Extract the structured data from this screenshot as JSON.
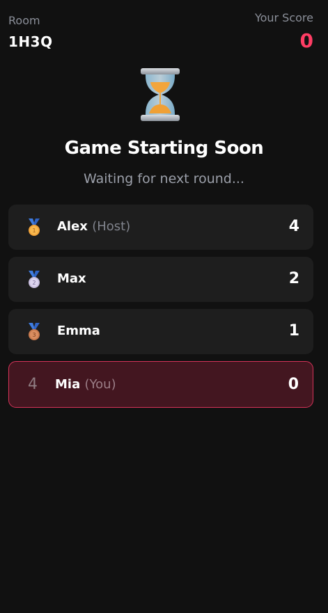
{
  "header": {
    "room_label": "Room",
    "room_code": "1H3Q",
    "score_label": "Your Score",
    "score_value": "0",
    "score_color": "#ff3d64"
  },
  "status": {
    "icon": "hourglass-icon",
    "title": "Game Starting Soon",
    "subtitle": "Waiting for next round..."
  },
  "leaderboard": [
    {
      "rank": "1",
      "medal": "gold-medal-icon",
      "name": "Alex",
      "tag": "(Host)",
      "score": "4"
    },
    {
      "rank": "2",
      "medal": "silver-medal-icon",
      "name": "Max",
      "tag": "",
      "score": "2"
    },
    {
      "rank": "3",
      "medal": "bronze-medal-icon",
      "name": "Emma",
      "tag": "",
      "score": "1"
    },
    {
      "rank": "4",
      "medal": "",
      "name": "Mia",
      "tag": "(You)",
      "score": "0",
      "is_you": true
    }
  ],
  "colors": {
    "background": "#111111",
    "row": "#1e1e1e",
    "you_row": "#431620",
    "you_border": "#d6335a"
  }
}
